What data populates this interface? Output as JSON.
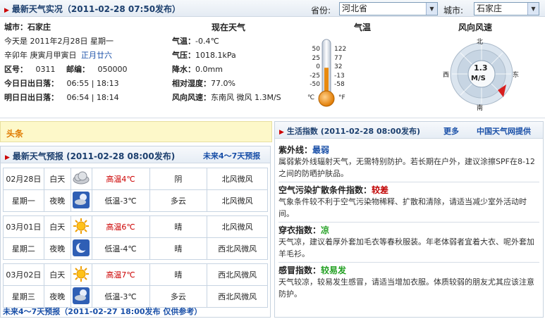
{
  "header": {
    "title": "最新天气实况（2011-02-28 07:50发布）",
    "province_label": "省份:",
    "province_value": "河北省",
    "city_label": "城市:",
    "city_value": "石家庄"
  },
  "current": {
    "city_line": "城市：石家庄",
    "today": "今天是 2011年2月28日 星期一",
    "lunar_prefix": "辛卯年 庚寅月甲寅日",
    "lunar_date": "正月廿六",
    "area_code_label": "区号：",
    "area_code": "0311",
    "postcode_label": "邮编：",
    "postcode": "050000",
    "sun_today_label": "今日日出日落：",
    "sun_today": "06:55 | 18:13",
    "sun_tomorrow_label": "明日日出日落：",
    "sun_tomorrow": "06:54 | 18:14"
  },
  "now": {
    "heading": "现在天气",
    "temp_label": "气温：",
    "temp": "-0.4℃",
    "pressure_label": "气压：",
    "pressure": "1018.1kPa",
    "precip_label": "降水：",
    "precip": "0.0mm",
    "humidity_label": "相对湿度：",
    "humidity": "77.0%",
    "wind_label": "风向风速：",
    "wind": "东南风 微风 1.3M/S"
  },
  "thermo": {
    "heading": "气温",
    "c_ticks": [
      "50",
      "25",
      "0",
      "-25",
      "-50"
    ],
    "f_ticks": [
      "122",
      "77",
      "32",
      "-13",
      "-58"
    ],
    "c_unit": "℃",
    "f_unit": "°F",
    "level_c": -0.4
  },
  "wind": {
    "heading": "风向风速",
    "speed": "1.3",
    "unit": "M/S",
    "north": "北",
    "south": "南",
    "east": "东",
    "west": "西"
  },
  "toutiao": {
    "label": "头条"
  },
  "forecast": {
    "title": "最新天气预报 (2011-02-28 08:00发布)",
    "link": "未来4～7天预报",
    "days": [
      {
        "date": "02月28日",
        "weekday": "星期一",
        "day": {
          "period": "白天",
          "icon": "cloudy-icon",
          "temp": "高温4℃",
          "weather": "阴",
          "wind": "北风微风"
        },
        "night": {
          "period": "夜晚",
          "icon": "cloudy-night-icon",
          "temp": "低温-3℃",
          "weather": "多云",
          "wind": "北风微风"
        }
      },
      {
        "date": "03月01日",
        "weekday": "星期二",
        "day": {
          "period": "白天",
          "icon": "sun-icon",
          "temp": "高温6℃",
          "weather": "晴",
          "wind": "北风微风"
        },
        "night": {
          "period": "夜晚",
          "icon": "moon-icon",
          "temp": "低温-4℃",
          "weather": "晴",
          "wind": "西北风微风"
        }
      },
      {
        "date": "03月02日",
        "weekday": "星期三",
        "day": {
          "period": "白天",
          "icon": "sun-icon",
          "temp": "高温7℃",
          "weather": "晴",
          "wind": "西北风微风"
        },
        "night": {
          "period": "夜晚",
          "icon": "cloudy-night-icon",
          "temp": "低温-3℃",
          "weather": "多云",
          "wind": "西北风微风"
        }
      }
    ],
    "footer": "未来4～7天预报（2011-02-27 18:00发布 仅供参考）"
  },
  "life": {
    "title": "生活指数 (2011-02-28 08:00发布)",
    "more": "更多",
    "source": "中国天气网提供",
    "items": [
      {
        "name": "紫外线：",
        "value": "最弱",
        "color": "#1a50a8",
        "desc": "属弱紫外线辐射天气，无需特别防护。若长期在户外，建议涂擦SPF在8-12之间的防晒护肤品。"
      },
      {
        "name": "空气污染扩散条件指数：",
        "value": "较差",
        "color": "#c00000",
        "desc": "气象条件较不利于空气污染物稀释、扩散和清除，请适当减少室外活动时间。"
      },
      {
        "name": "穿衣指数：",
        "value": "凉",
        "color": "#22a022",
        "desc": "天气凉，建议着厚外套加毛衣等春秋服装。年老体弱者宜着大衣、呢外套加羊毛衫。"
      },
      {
        "name": "感冒指数：",
        "value": "较易发",
        "color": "#22a022",
        "desc": "天气较凉，较易发生感冒，请适当增加衣服。体质较弱的朋友尤其应该注意防护。"
      }
    ]
  }
}
